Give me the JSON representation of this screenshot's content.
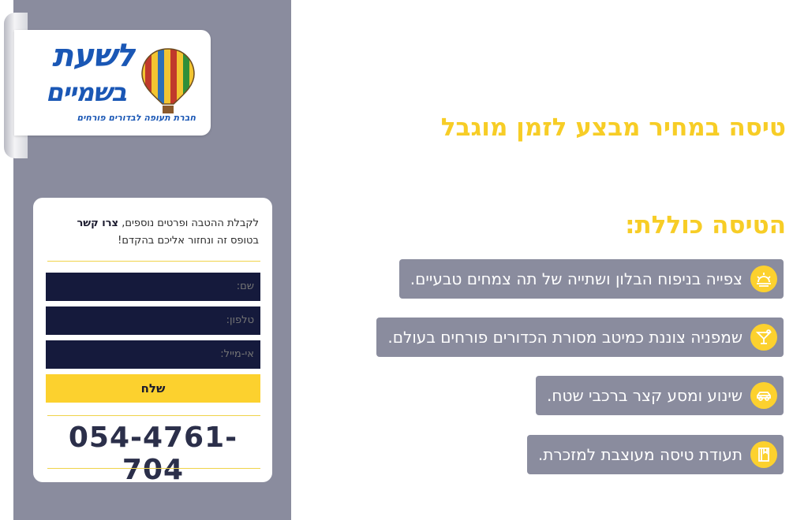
{
  "logo": {
    "line1": "לשעת",
    "line2": "בשמיים",
    "tagline": "חברת תעופה לבדורים פורחים"
  },
  "form": {
    "intro_before": "לקבלת ההטבה ופרטים נוספים,",
    "intro_bold": "צרו קשר",
    "intro_after": "בטופס זה ונחזור אליכם בהקדם!",
    "name_placeholder": "שם:",
    "phone_placeholder": "טלפון:",
    "email_placeholder": "אי-מייל:",
    "submit_label": "שלח",
    "phone_number": "054-4761-704"
  },
  "content": {
    "headline": "טיסה במחיר מבצע לזמן מוגבל",
    "subhead": "הטיסה כוללת:",
    "features": [
      {
        "text": "צפייה בניפוח הבלון ושתייה של תה צמחים טבעיים.",
        "icon": "sunrise-icon"
      },
      {
        "text": "שמפניה צוננת כמיטב מסורת הכדורים פורחים בעולם.",
        "icon": "cocktail-icon"
      },
      {
        "text": "שינוע ומסע קצר ברכבי שטח.",
        "icon": "car-icon"
      },
      {
        "text": "תעודת טיסה מעוצבת למזכרת.",
        "icon": "certificate-icon"
      }
    ]
  },
  "colors": {
    "accent": "#fcd12e",
    "panel": "#8a8c9e",
    "field": "#151a3c"
  }
}
